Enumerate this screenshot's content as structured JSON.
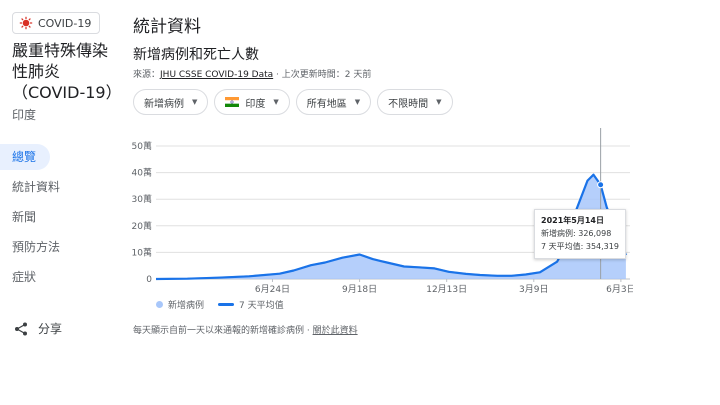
{
  "chip": {
    "label": "COVID-19",
    "icon": "virus-icon",
    "color": "#d93025"
  },
  "title_lines": [
    "嚴重特殊傳染",
    "性肺炎",
    "（COVID-19）"
  ],
  "region": "印度",
  "nav": [
    {
      "label": "總覽",
      "active": true
    },
    {
      "label": "統計資料",
      "active": false
    },
    {
      "label": "新聞",
      "active": false
    },
    {
      "label": "預防方法",
      "active": false
    },
    {
      "label": "症狀",
      "active": false
    }
  ],
  "share_label": "分享",
  "main": {
    "heading": "統計資料",
    "subheading": "新增病例和死亡人數",
    "source_prefix": "來源：",
    "source_link": "JHU CSSE COVID-19 Data",
    "source_suffix": " · 上次更新時間：2 天前",
    "filters": [
      "新增病例",
      "印度",
      "所有地區",
      "不限時間"
    ]
  },
  "tooltip": {
    "date": "2021年5月14日",
    "cases_line": "新增病例: 326,098",
    "avg_line": "7 天平均值: 354,319"
  },
  "legend": {
    "cases": "新增病例",
    "avg": "7 天平均值"
  },
  "footnote": {
    "text": "每天顯示自前一天以來通報的新增確診病例 · ",
    "link": "關於此資料"
  },
  "colors": {
    "accent": "#1a73e8",
    "bars": "#a8c7fa",
    "grid": "#e0e0e0"
  },
  "chart_data": {
    "type": "area",
    "y_ticks": [
      "0",
      "10萬",
      "20萬",
      "30萬",
      "40萬",
      "50萬"
    ],
    "ylim": [
      0,
      500000
    ],
    "x_tick_labels": [
      "6月24日",
      "9月18日",
      "12月13日",
      "3月9日",
      "6月3日"
    ],
    "series": [
      {
        "name": "7 天平均值",
        "x": [
          "2020-03-01",
          "2020-04-01",
          "2020-05-01",
          "2020-06-01",
          "2020-07-01",
          "2020-07-15",
          "2020-08-01",
          "2020-08-15",
          "2020-09-01",
          "2020-09-18",
          "2020-10-01",
          "2020-10-15",
          "2020-11-01",
          "2020-11-15",
          "2020-12-01",
          "2020-12-15",
          "2021-01-01",
          "2021-01-15",
          "2021-02-01",
          "2021-02-15",
          "2021-03-01",
          "2021-03-15",
          "2021-04-01",
          "2021-04-10",
          "2021-04-20",
          "2021-05-01",
          "2021-05-07",
          "2021-05-14",
          "2021-05-20",
          "2021-05-27",
          "2021-06-03",
          "2021-06-08"
        ],
        "values": [
          0,
          1000,
          5000,
          10000,
          20000,
          32000,
          52000,
          62000,
          80000,
          92000,
          75000,
          62000,
          47000,
          44000,
          40000,
          27000,
          19000,
          15000,
          12000,
          12000,
          17000,
          25000,
          65000,
          130000,
          260000,
          370000,
          392000,
          354319,
          270000,
          200000,
          130000,
          90000
        ]
      }
    ]
  }
}
